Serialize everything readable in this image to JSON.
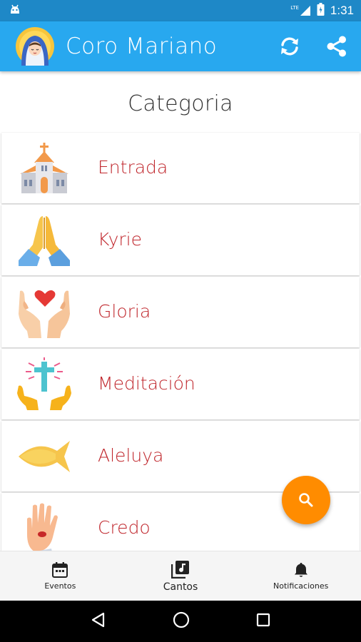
{
  "status_bar": {
    "network": "LTE",
    "time": "1:31"
  },
  "app_bar": {
    "title": "Coro Mariano"
  },
  "page": {
    "title": "Categoria"
  },
  "categories": [
    {
      "label": "Entrada",
      "icon": "church-icon"
    },
    {
      "label": "Kyrie",
      "icon": "praying-hands-icon"
    },
    {
      "label": "Gloria",
      "icon": "hands-heart-icon"
    },
    {
      "label": "Meditación",
      "icon": "hands-cross-icon"
    },
    {
      "label": "Aleluya",
      "icon": "ichthys-fish-icon"
    },
    {
      "label": "Credo",
      "icon": "hand-wound-icon"
    }
  ],
  "bottom_nav": {
    "items": [
      {
        "label": "Eventos",
        "icon": "calendar-icon"
      },
      {
        "label": "Cantos",
        "icon": "music-library-icon"
      },
      {
        "label": "Notificaciones",
        "icon": "bell-icon"
      }
    ]
  },
  "colors": {
    "status_bar": "#1e88c7",
    "app_bar": "#28a8ef",
    "category_text": "#c0272d",
    "fab": "#ff8c00"
  }
}
